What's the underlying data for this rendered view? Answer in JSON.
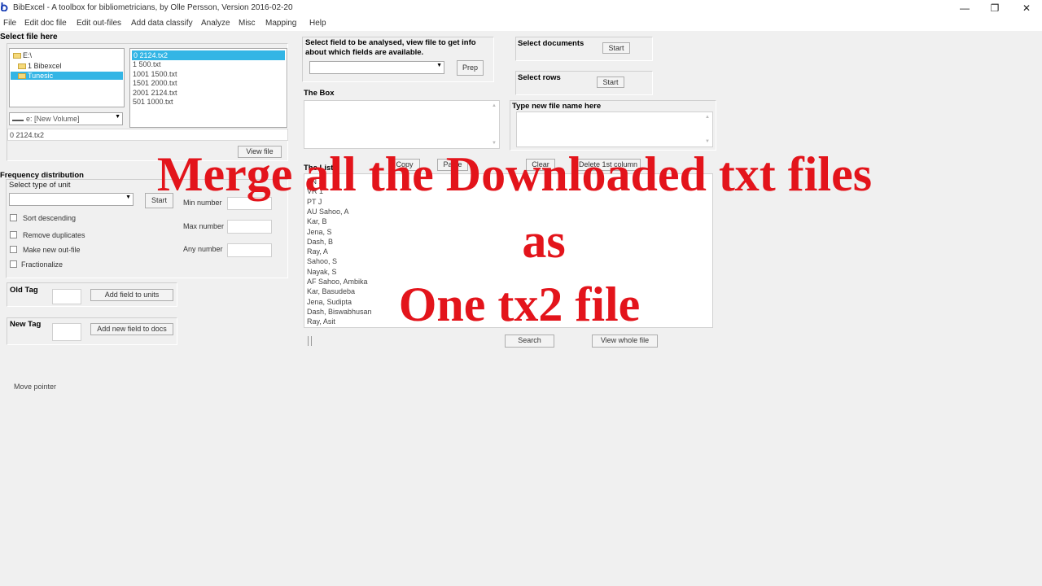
{
  "window": {
    "title": "BibExcel - A toolbox for bibliometricians, by Olle Persson, Version 2016-02-20",
    "minimize": "—",
    "maximize": "❐",
    "close": "✕"
  },
  "menu": [
    "File",
    "Edit doc file",
    "Edit out-files",
    "Add data classify",
    "Analyze",
    "Misc",
    "Mapping",
    "Help"
  ],
  "file_panel": {
    "label": "Select file here",
    "folders": [
      "E:\\",
      "1 Bibexcel",
      "Tunesic"
    ],
    "files": [
      "0 2124.tx2",
      "1 500.txt",
      "1001 1500.txt",
      "1501 2000.txt",
      "2001 2124.txt",
      "501 1000.txt"
    ],
    "drive": "e: [New Volume]",
    "path": "0 2124.tx2",
    "view_file_button": "View file"
  },
  "field_panel": {
    "label": "Select field to be analysed, view file to get info about which fields are available.",
    "prep_button": "Prep"
  },
  "select_documents": {
    "label": "Select documents",
    "button": "Start"
  },
  "select_rows": {
    "label": "Select rows",
    "button": "Start"
  },
  "the_box": {
    "label": "The Box"
  },
  "new_file": {
    "label": "Type new file name here"
  },
  "the_list": {
    "label": "The List",
    "buttons": [
      "Copy",
      "Paste",
      "Clear",
      "Delete 1st column"
    ],
    "items": [
      "FN ... ",
      "VR 1",
      "PT J",
      "AU Sahoo, A",
      "   Kar, B",
      "   Jena, S",
      "   Dash, B",
      "   Ray, A",
      "   Sahoo, S",
      "   Nayak, S",
      "AF Sahoo, Ambika",
      "   Kar, Basudeba",
      "   Jena, Sudipta",
      "   Dash, Biswabhusan",
      "   Ray, Asit"
    ],
    "search_button": "Search",
    "view_whole_button": "View whole file"
  },
  "frequency": {
    "label": "Frequency distribution",
    "unit_label": "Select type of unit",
    "start_button": "Start",
    "checkboxes": [
      "Sort descending",
      "Remove duplicates",
      "Make new out-file",
      "Fractionalize"
    ],
    "min_label": "Min number",
    "max_label": "Max number",
    "any_label": "Any number"
  },
  "old_tag": {
    "label": "Old Tag",
    "button": "Add field to units"
  },
  "new_tag": {
    "label": "New Tag",
    "button": "Add new field to docs"
  },
  "status": "Move pointer",
  "overlay": [
    "Merge all the Downloaded txt files",
    "as",
    "One tx2 file"
  ],
  "colors": {
    "overlay": "#e3141b",
    "selection": "#33b5e5",
    "app_icon": "#1a3fb5"
  }
}
